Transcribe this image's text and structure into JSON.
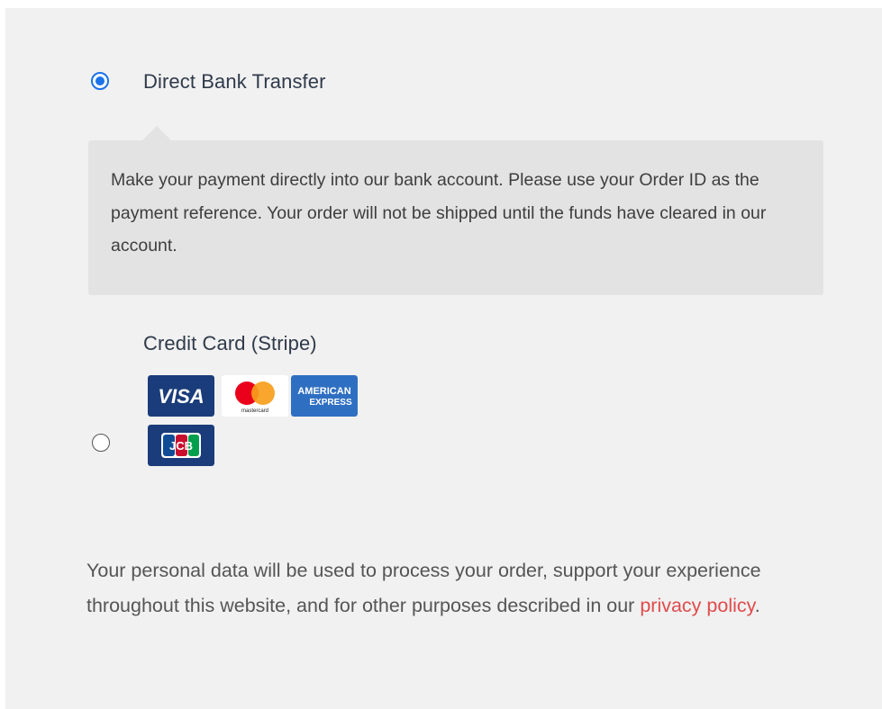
{
  "payment_methods": [
    {
      "label": "Direct Bank Transfer",
      "selected": true,
      "description": "Make your payment directly into our bank account. Please use your Order ID as the payment reference. Your order will not be shipped until the funds have cleared in our account."
    },
    {
      "label": "Credit Card (Stripe)",
      "selected": false,
      "card_logos": [
        "visa",
        "mastercard",
        "american-express",
        "jcb"
      ]
    }
  ],
  "card_logo_text": {
    "visa": "VISA",
    "mastercard": "mastercard",
    "amex_line1": "AMERICAN",
    "amex_line2": "EXPRESS",
    "jcb": "JCB"
  },
  "privacy": {
    "text_before_link": "Your personal data will be used to process your order, support your experience throughout this website, and for other purposes described in our ",
    "link_text": "privacy policy",
    "text_after_link": "."
  },
  "colors": {
    "panel_background": "#f1f1f1",
    "description_background": "#e3e3e3",
    "radio_selected": "#1a73e8",
    "link": "#e14b4b",
    "visa_blue": "#1a3c7a",
    "amex_blue": "#2f6fc2",
    "mastercard_red": "#eb001b",
    "mastercard_orange": "#f79e1b"
  }
}
